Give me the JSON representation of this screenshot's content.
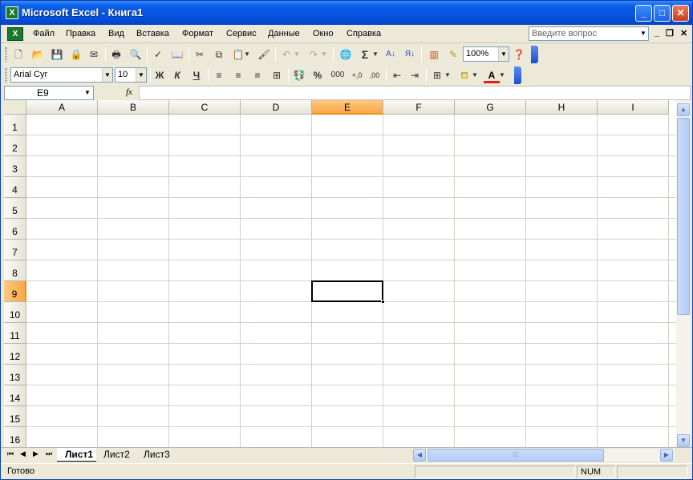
{
  "window": {
    "title": "Microsoft Excel - Книга1",
    "app_icon": "excel-icon",
    "minimize": "_",
    "maximize": "□",
    "close": "✕"
  },
  "menu": {
    "items": [
      "Файл",
      "Правка",
      "Вид",
      "Вставка",
      "Формат",
      "Сервис",
      "Данные",
      "Окно",
      "Справка"
    ],
    "help_placeholder": "Введите вопрос",
    "doc_minimize": "_",
    "doc_restore": "❐",
    "doc_close": "✕"
  },
  "standard_toolbar": {
    "zoom": "100%"
  },
  "format_toolbar": {
    "font": "Arial Cyr",
    "size": "10",
    "bold": "Ж",
    "italic": "К",
    "underline": "Ч",
    "percent": "%",
    "thousands": "000",
    "inc_decimal": "+,0",
    "dec_decimal": ",00"
  },
  "formula_bar": {
    "name_box": "E9",
    "fx": "fx",
    "formula": ""
  },
  "grid": {
    "columns": [
      "A",
      "B",
      "C",
      "D",
      "E",
      "F",
      "G",
      "H",
      "I"
    ],
    "rows": [
      "1",
      "2",
      "3",
      "4",
      "5",
      "6",
      "7",
      "8",
      "9",
      "10",
      "11",
      "12",
      "13",
      "14",
      "15",
      "16"
    ],
    "active_cell": "E9"
  },
  "sheets": {
    "tabs": [
      "Лист1",
      "Лист2",
      "Лист3"
    ],
    "active": "Лист1"
  },
  "status": {
    "text": "Готово",
    "num": "NUM"
  }
}
